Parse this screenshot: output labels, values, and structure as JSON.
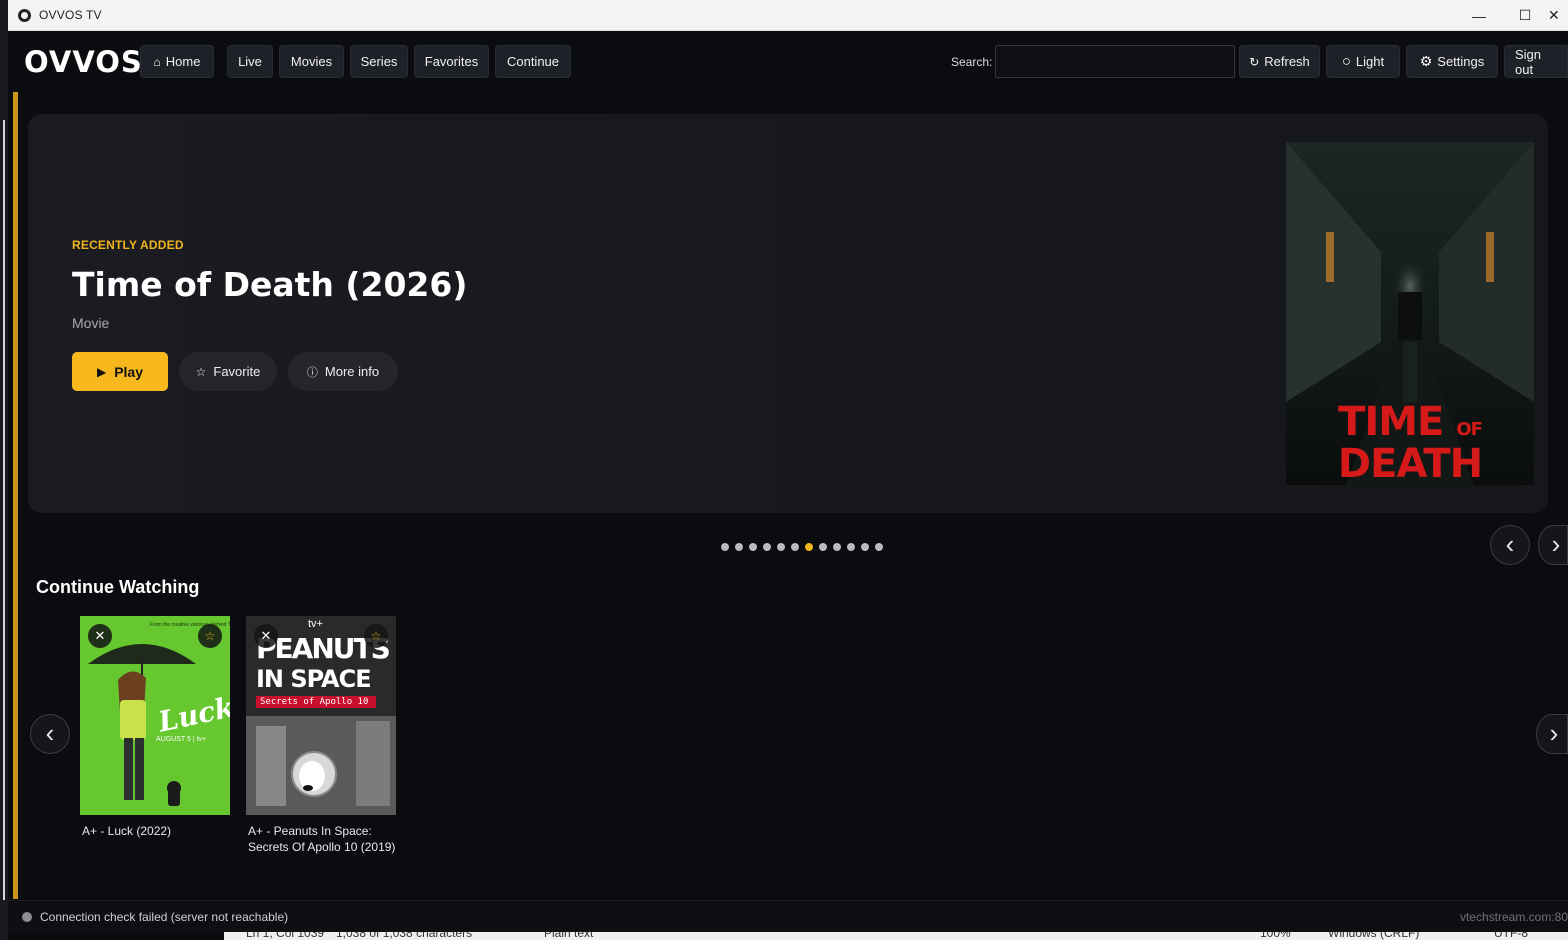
{
  "window": {
    "title": "OVVOS TV",
    "minimize": "—",
    "maximize": "☐",
    "close": "✕"
  },
  "nav": {
    "logo": "OVVOS",
    "items": [
      {
        "label": "Home",
        "icon": "⌂"
      },
      {
        "label": "Live"
      },
      {
        "label": "Movies"
      },
      {
        "label": "Series"
      },
      {
        "label": "Favorites"
      },
      {
        "label": "Continue"
      }
    ],
    "search_label": "Search:",
    "search_value": "",
    "refresh": {
      "label": "Refresh",
      "icon": "↻"
    },
    "theme": {
      "label": "Light",
      "icon": "○"
    },
    "settings": {
      "label": "Settings",
      "icon": "⚙"
    },
    "signout": {
      "label": "Sign out"
    }
  },
  "hero": {
    "tag": "RECENTLY ADDED",
    "title": "Time of Death (2026)",
    "subtitle": "Movie",
    "play_label": "Play",
    "play_icon": "▶",
    "favorite_label": "Favorite",
    "favorite_icon": "☆",
    "info_label": "More info",
    "info_icon": "ⓘ",
    "poster": {
      "line1": "TIME",
      "line1_small": "OF",
      "line2": "DEATH"
    }
  },
  "carousel": {
    "dot_count": 12,
    "active_index": 6,
    "prev_icon": "‹",
    "next_icon": "›"
  },
  "continue_watching": {
    "title": "Continue Watching",
    "items": [
      {
        "caption": "A+ - Luck  (2022)",
        "poster_title": "Luck",
        "poster_sub": "AUGUST 5 | tv+",
        "remove_icon": "✕",
        "fav_icon": "☆"
      },
      {
        "caption": "A+ - Peanuts In Space: Secrets Of Apollo 10 (2019)",
        "poster_title": "PEANUTS",
        "poster_title2": "IN SPACE",
        "poster_tagline": "Secrets of Apollo 10",
        "poster_brand": "tv+",
        "remove_icon": "✕",
        "fav_icon": "☆"
      }
    ]
  },
  "status": {
    "text": "Connection check failed (server not reachable)",
    "url": "vtechstream.com:80"
  },
  "background_window": {
    "cursor": "Ln 1, Col 1039",
    "chars": "1,038 of 1,038 characters",
    "format": "Plain text",
    "zoom": "100%",
    "eol": "Windows (CRLF)",
    "encoding": "UTF-8"
  }
}
